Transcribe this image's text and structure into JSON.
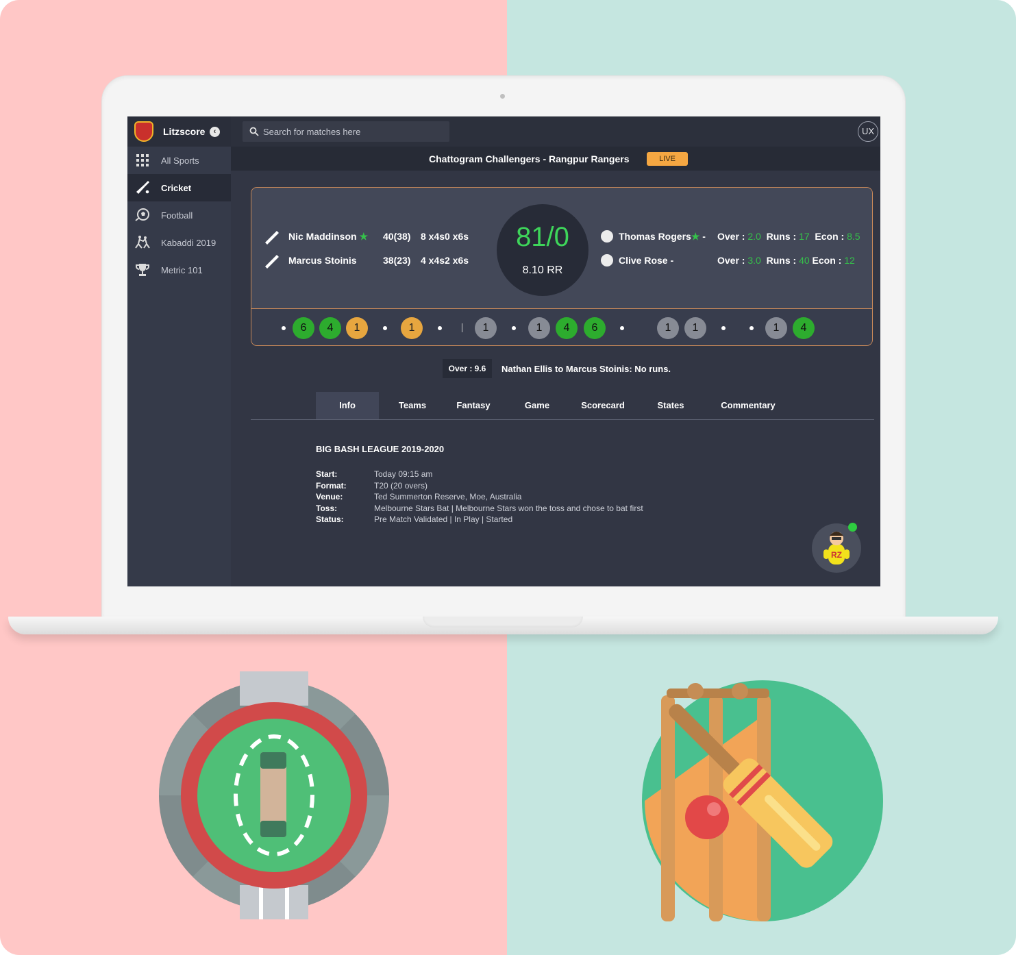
{
  "sidebar": {
    "brand": "Litzscore",
    "items": [
      {
        "label": "All Sports",
        "icon": "grid-icon"
      },
      {
        "label": "Cricket",
        "icon": "cricket-bat-icon",
        "active": true
      },
      {
        "label": "Football",
        "icon": "football-icon"
      },
      {
        "label": "Kabaddi 2019",
        "icon": "kabaddi-icon"
      },
      {
        "label": "Metric 101",
        "icon": "trophy-icon"
      }
    ]
  },
  "search": {
    "placeholder": "Search for matches here"
  },
  "header": {
    "avatar_initials": "UX"
  },
  "match": {
    "title": "Chattogram Challengers - Rangpur Rangers",
    "status": "LIVE"
  },
  "batsmen": [
    {
      "name": "Nic Maddinson",
      "star": "★",
      "score": "40(38)",
      "extra": "8 x4s0 x6s"
    },
    {
      "name": "Marcus Stoinis",
      "star": "",
      "score": "38(23)",
      "extra": "4 x4s2 x6s"
    }
  ],
  "score": {
    "total": "81/0",
    "run_rate": "8.10 RR"
  },
  "bowlers": [
    {
      "name": "Thomas Rogers",
      "star": "★",
      "suffix": " -",
      "over_label": "Over :",
      "over": "2.0",
      "runs_label": "Runs :",
      "runs": "17",
      "econ_label": "Econ :",
      "econ": "8.5"
    },
    {
      "name": "Clive Rose",
      "star": "",
      "suffix": " -",
      "over_label": "Over :",
      "over": "3.0",
      "runs_label": "Runs :",
      "runs": "40",
      "econ_label": "Econ :",
      "econ": "12"
    }
  ],
  "balls": [
    {
      "type": "dot"
    },
    {
      "type": "ball",
      "value": "6",
      "color": "green"
    },
    {
      "type": "ball",
      "value": "4",
      "color": "green"
    },
    {
      "type": "ball",
      "value": "1",
      "color": "gold"
    },
    {
      "type": "dot"
    },
    {
      "type": "ball",
      "value": "1",
      "color": "gold"
    },
    {
      "type": "dot"
    },
    {
      "type": "sep"
    },
    {
      "type": "ball",
      "value": "1",
      "color": "grey"
    },
    {
      "type": "dot"
    },
    {
      "type": "ball",
      "value": "1",
      "color": "grey"
    },
    {
      "type": "ball",
      "value": "4",
      "color": "green"
    },
    {
      "type": "ball",
      "value": "6",
      "color": "green"
    },
    {
      "type": "dot"
    },
    {
      "type": "ball",
      "value": "1",
      "color": "grey"
    },
    {
      "type": "ball",
      "value": "1",
      "color": "grey"
    },
    {
      "type": "dot"
    },
    {
      "type": "dot"
    },
    {
      "type": "ball",
      "value": "1",
      "color": "grey"
    },
    {
      "type": "ball",
      "value": "4",
      "color": "green"
    }
  ],
  "last_ball": {
    "over": "Over : 9.6",
    "text": "Nathan Ellis to Marcus Stoinis: No runs."
  },
  "tabs": [
    "Info",
    "Teams",
    "Fantasy",
    "Game",
    "Scorecard",
    "States",
    "Commentary"
  ],
  "info": {
    "title": "BIG BASH LEAGUE 2019-2020",
    "rows": [
      {
        "k": "Start:",
        "v": "Today 09:15 am"
      },
      {
        "k": "Format:",
        "v": "T20 (20 overs)"
      },
      {
        "k": "Venue:",
        "v": "Ted Summerton Reserve, Moe, Australia"
      },
      {
        "k": "Toss:",
        "v": "Melbourne Stars Bat | Melbourne Stars won the toss and chose to bat first"
      },
      {
        "k": "Status:",
        "v": "Pre Match Validated | In Play | Started"
      }
    ]
  },
  "chatbot": {
    "label": "RZ"
  },
  "colors": {
    "accent_green": "#35c24a",
    "live_orange": "#f5a742",
    "card_border": "#c78859",
    "bg_left": "#ffc7c6",
    "bg_right": "#c5e6e0"
  }
}
